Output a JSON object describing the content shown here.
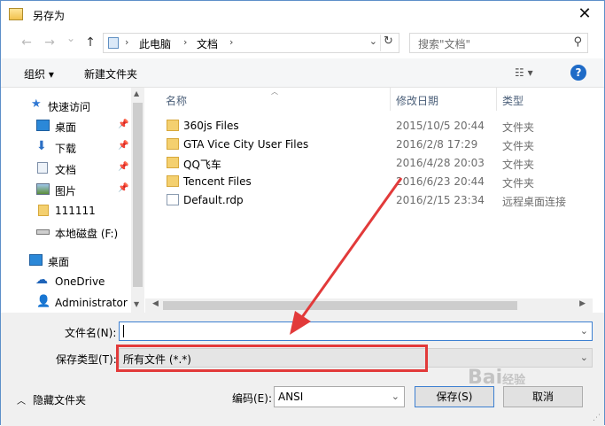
{
  "window": {
    "title": "另存为",
    "close_glyph": "✕"
  },
  "nav": {
    "back_glyph": "←",
    "forward_glyph": "→",
    "dropdown_glyph": "⌄",
    "up_glyph": "↑",
    "breadcrumbs": [
      "此电脑",
      "文档"
    ],
    "crumb_sep": "›",
    "refresh_glyph": "↻",
    "search_placeholder": "搜索\"文档\"",
    "search_glyph": "⚲"
  },
  "toolbar": {
    "organize_label": "组织 ▾",
    "new_folder_label": "新建文件夹",
    "view_glyph": "☷ ▾",
    "help_glyph": "?"
  },
  "sidebar": {
    "items": [
      {
        "label": "快速访问",
        "icon": "star-icon",
        "pinned": false
      },
      {
        "label": "桌面",
        "icon": "desktop-icon",
        "pinned": true
      },
      {
        "label": "下载",
        "icon": "download-icon",
        "pinned": true
      },
      {
        "label": "文档",
        "icon": "document-icon",
        "pinned": true
      },
      {
        "label": "图片",
        "icon": "picture-icon",
        "pinned": true
      },
      {
        "label": "111111",
        "icon": "folder-icon",
        "pinned": false
      },
      {
        "label": "本地磁盘 (F:)",
        "icon": "drive-icon",
        "pinned": false
      },
      {
        "label": "桌面",
        "icon": "desktop-icon",
        "pinned": false
      },
      {
        "label": "OneDrive",
        "icon": "cloud-icon",
        "pinned": false
      },
      {
        "label": "Administrator",
        "icon": "user-icon",
        "pinned": false
      }
    ],
    "pin_glyph": "📌"
  },
  "files": {
    "columns": [
      "名称",
      "修改日期",
      "类型"
    ],
    "rows": [
      {
        "name": "360js Files",
        "date": "2015/10/5 20:44",
        "type": "文件夹",
        "icon": "folder-icon"
      },
      {
        "name": "GTA Vice City User Files",
        "date": "2016/2/8 17:29",
        "type": "文件夹",
        "icon": "folder-icon"
      },
      {
        "name": "QQ飞车",
        "date": "2016/4/28 20:03",
        "type": "文件夹",
        "icon": "folder-icon"
      },
      {
        "name": "Tencent Files",
        "date": "2016/6/23 20:44",
        "type": "文件夹",
        "icon": "folder-icon"
      },
      {
        "name": "Default.rdp",
        "date": "2016/2/15 23:34",
        "type": "远程桌面连接",
        "icon": "rdp-file-icon"
      }
    ]
  },
  "form": {
    "filename_label": "文件名(N):",
    "filename_value": "",
    "filetype_label": "保存类型(T):",
    "filetype_value": "所有文件  (*.*)",
    "hide_folders_label": "隐藏文件夹",
    "encoding_label": "编码(E):",
    "encoding_value": "ANSI",
    "save_label": "保存(S)",
    "cancel_label": "取消"
  },
  "annotation": {
    "arrow_color": "#e23a3a",
    "box_color": "#e23a3a"
  },
  "watermark": {
    "text": "Bai",
    "sub": "经验"
  }
}
